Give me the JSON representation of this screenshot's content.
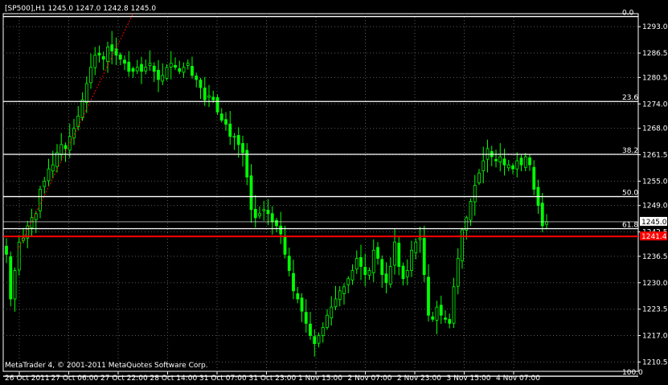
{
  "header": {
    "symbol_info": "[SP500],H1  1245.0 1247.0 1242.8 1245.0"
  },
  "watermark": "MetaTrader 4, © 2001-2011 MetaQuotes Software Corp.",
  "colors": {
    "background": "#000000",
    "axis": "#ffffff",
    "bull_bar": "#00ff00",
    "bear_bar": "#00ff00",
    "fib_line": "#ffffff",
    "support_line": "#ff0000",
    "price_tag_bg": "#ffffff",
    "support_tag_bg": "#ff0000",
    "trend_line": "#ff0000"
  },
  "chart_data": {
    "type": "candlestick",
    "timeframe": "H1",
    "symbol": "[SP500]",
    "ylim": [
      1208.2,
      1296.2
    ],
    "y_ticks": [
      "1293.0",
      "1286.5",
      "1280.5",
      "1274.0",
      "1268.0",
      "1261.5",
      "1255.0",
      "1249.0",
      "1242.5",
      "1236.5",
      "1230.0",
      "1223.5",
      "1217.0",
      "1210.5"
    ],
    "x_ticks": [
      "26 Oct 2011",
      "27 Oct 06:00",
      "27 Oct 22:00",
      "28 Oct 14:00",
      "31 Oct 07:00",
      "31 Oct 23:00",
      "1 Nov 15:00",
      "2 Nov 07:00",
      "2 Nov 23:00",
      "3 Nov 15:00",
      "4 Nov 07:00"
    ],
    "current_price": "1245.0",
    "support_level": "1241.4",
    "support_value": 1241.4,
    "fibonacci": [
      {
        "label": "0.0",
        "price": 1295.5
      },
      {
        "label": "23.6",
        "price": 1274.6
      },
      {
        "label": "38.2",
        "price": 1261.6
      },
      {
        "label": "50.0",
        "price": 1251.2
      },
      {
        "label": "61.8",
        "price": 1243.3
      },
      {
        "label": "100.0",
        "price": 1207.0
      }
    ],
    "closes": [
      1237,
      1226,
      1233,
      1240,
      1241,
      1244,
      1246,
      1247,
      1253,
      1255,
      1258,
      1259,
      1262,
      1264,
      1263,
      1266,
      1268,
      1271,
      1275,
      1279,
      1283,
      1286,
      1286,
      1285,
      1288,
      1287,
      1286,
      1285,
      1284,
      1282,
      1282,
      1283,
      1282,
      1283,
      1284,
      1282,
      1280,
      1281,
      1283,
      1284,
      1283,
      1282,
      1283,
      1284,
      1281,
      1280,
      1278,
      1275,
      1276,
      1275,
      1272,
      1270,
      1269,
      1266,
      1266,
      1264,
      1262,
      1256,
      1248,
      1246,
      1247,
      1248,
      1247,
      1245,
      1244,
      1242,
      1237,
      1233,
      1228,
      1226,
      1223,
      1220,
      1217,
      1215,
      1217,
      1219,
      1222,
      1224,
      1226,
      1228,
      1229,
      1231,
      1233,
      1236,
      1234,
      1232,
      1233,
      1238,
      1236,
      1232,
      1230,
      1234,
      1240,
      1234,
      1231,
      1233,
      1238,
      1240,
      1241,
      1232,
      1222,
      1221,
      1224,
      1222,
      1221,
      1220,
      1229,
      1236,
      1243,
      1246,
      1250,
      1254,
      1257,
      1260,
      1263,
      1261,
      1260,
      1261,
      1259,
      1259,
      1258,
      1260,
      1259,
      1261,
      1259,
      1253,
      1249,
      1244,
      1245
    ]
  }
}
